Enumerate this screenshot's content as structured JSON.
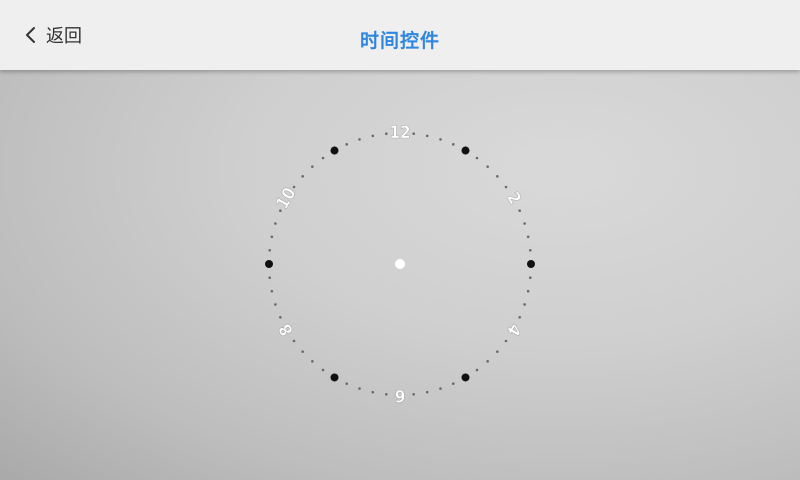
{
  "header": {
    "back_label": "返回",
    "title": "时间控件"
  },
  "clock": {
    "hour_labels": [
      "12",
      "2",
      "4",
      "6",
      "8",
      "10"
    ],
    "colors": {
      "hour_dot": "#111111",
      "minute_dot": "#6a6a6a",
      "center_dot": "#ffffff",
      "label": "#ffffff",
      "title": "#2f86e0"
    }
  },
  "icons": {
    "back": "chevron-left-icon"
  }
}
